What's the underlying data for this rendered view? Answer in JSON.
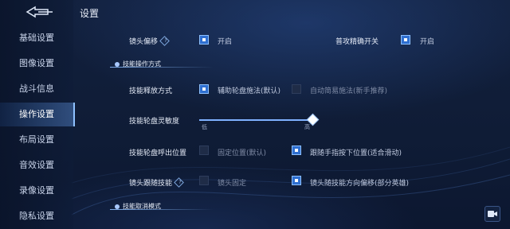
{
  "page_title": "设置",
  "sidebar": {
    "items": [
      {
        "label": "基础设置"
      },
      {
        "label": "图像设置"
      },
      {
        "label": "战斗信息"
      },
      {
        "label": "操作设置"
      },
      {
        "label": "布局设置"
      },
      {
        "label": "音效设置"
      },
      {
        "label": "录像设置"
      },
      {
        "label": "隐私设置"
      }
    ],
    "active": "操作设置"
  },
  "rows": {
    "lens_offset": {
      "label": "镜头偏移",
      "option": "开启",
      "checked": true
    },
    "normal_attack_precise": {
      "label": "普攻精确开关",
      "option": "开启",
      "checked": true
    },
    "section_skill_method": "技能操作方式",
    "release_method": {
      "label": "技能释放方式",
      "option_a": "辅助轮盘施法(默认)",
      "option_a_checked": true,
      "option_b": "自动简易施法(新手推荐)",
      "option_b_checked": false
    },
    "wheel_sensitivity": {
      "label": "技能轮盘灵敏度",
      "low": "低",
      "high": "高",
      "level": 1.0
    },
    "wheel_position": {
      "label": "技能轮盘呼出位置",
      "option_a": "固定位置(默认)",
      "option_a_checked": false,
      "option_b": "跟随手指按下位置(适合滑动)",
      "option_b_checked": true
    },
    "lens_follow": {
      "label": "镜头跟随技能",
      "option_a": "镜头固定",
      "option_a_checked": false,
      "option_b": "镜头随技能方向偏移(部分英雄)",
      "option_b_checked": true
    },
    "section_cancel_mode": "技能取消模式"
  },
  "icons": {
    "back": "back-arrow-icon",
    "help": "question-diamond-icon",
    "camera": "video-camera-icon"
  },
  "colors": {
    "accent": "#2f6fd0",
    "background": "#0e1a33",
    "highlight": "#8ec1ff"
  }
}
